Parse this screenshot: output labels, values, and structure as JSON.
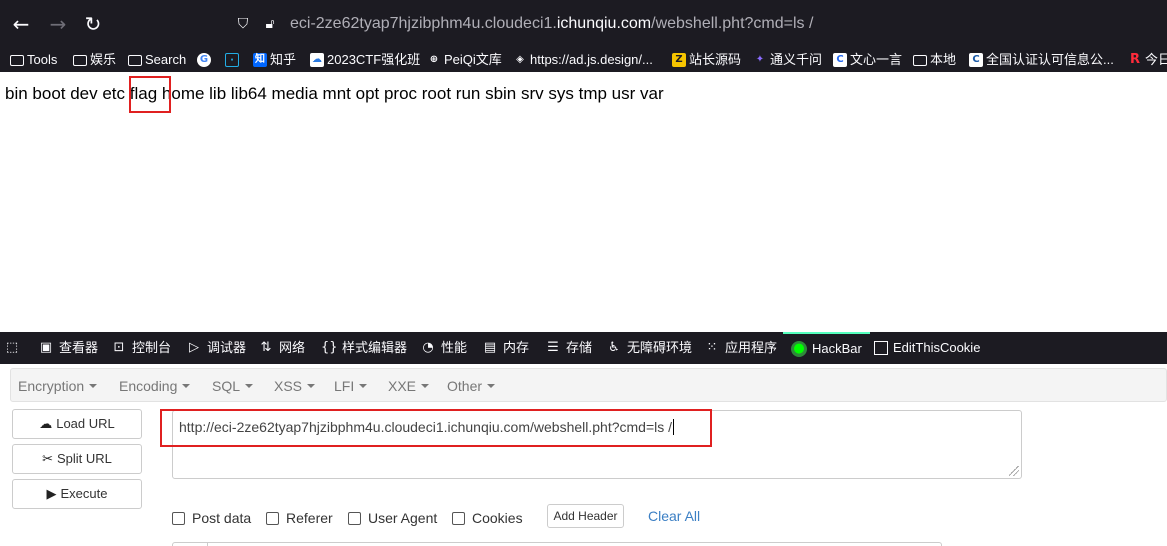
{
  "browser": {
    "url": {
      "prefix": "eci-2ze62tyap7hjzibphm4u.cloudeci1.",
      "host": "ichunqiu.com",
      "suffix": "/webshell.pht?cmd=ls /"
    },
    "nav_icons": {
      "back": "arrow-left-icon",
      "forward": "arrow-right-icon",
      "reload": "reload-icon"
    }
  },
  "bookmarks": [
    {
      "label": "Tools",
      "icon": "folder-icon"
    },
    {
      "label": "娱乐",
      "icon": "folder-icon"
    },
    {
      "label": "Search",
      "icon": "folder-icon"
    },
    {
      "label": "",
      "icon": "google-icon"
    },
    {
      "label": "",
      "icon": "bilibili-icon"
    },
    {
      "label": "知乎",
      "icon": "zhihu-icon"
    },
    {
      "label": "2023CTF强化班",
      "icon": "cloud-icon"
    },
    {
      "label": "PeiQi文库",
      "icon": "globe-icon"
    },
    {
      "label": "https://ad.js.design/...",
      "icon": "jsdesign-icon"
    },
    {
      "label": "站长源码",
      "icon": "zz-icon"
    },
    {
      "label": "通义千问",
      "icon": "tongyi-icon"
    },
    {
      "label": "文心一言",
      "icon": "wenxin-icon"
    },
    {
      "label": "本地",
      "icon": "folder-icon"
    },
    {
      "label": "全国认证认可信息公...",
      "icon": "cert-icon"
    },
    {
      "label": "今日",
      "icon": "r-icon"
    }
  ],
  "page": {
    "output_before": "bin boot dev etc ",
    "output_flag": "flag",
    "output_after": " home lib lib64 media mnt opt proc root run sbin srv sys tmp usr var"
  },
  "devtools": {
    "tabs": [
      {
        "label": "",
        "icon": "pick-element-icon"
      },
      {
        "label": "查看器",
        "icon": "inspector-icon"
      },
      {
        "label": "控制台",
        "icon": "console-icon"
      },
      {
        "label": "调试器",
        "icon": "debugger-icon"
      },
      {
        "label": "网络",
        "icon": "network-icon"
      },
      {
        "label": "样式编辑器",
        "icon": "style-editor-icon"
      },
      {
        "label": "性能",
        "icon": "performance-icon"
      },
      {
        "label": "内存",
        "icon": "memory-icon"
      },
      {
        "label": "存储",
        "icon": "storage-icon"
      },
      {
        "label": "无障碍环境",
        "icon": "accessibility-icon"
      },
      {
        "label": "应用程序",
        "icon": "application-icon"
      },
      {
        "label": "HackBar",
        "icon": "hackbar-icon"
      },
      {
        "label": "EditThisCookie",
        "icon": "cookie-icon"
      }
    ],
    "active_tab": "HackBar"
  },
  "hackbar": {
    "menu": [
      "Encryption",
      "Encoding",
      "SQL",
      "XSS",
      "LFI",
      "XXE",
      "Other"
    ],
    "buttons": {
      "load": "Load URL",
      "split": "Split URL",
      "execute": "Execute"
    },
    "url_value": "http://eci-2ze62tyap7hjzibphm4u.cloudeci1.ichunqiu.com/webshell.pht?cmd=ls /",
    "checks": [
      "Post data",
      "Referer",
      "User Agent",
      "Cookies"
    ],
    "add_header": "Add Header",
    "clear_all": "Clear All"
  },
  "colors": {
    "chrome_bg": "#1c1b22",
    "annotation_red": "#e02020",
    "hackbar_active": "#54ffbd",
    "link_blue": "#3b7fc4"
  }
}
